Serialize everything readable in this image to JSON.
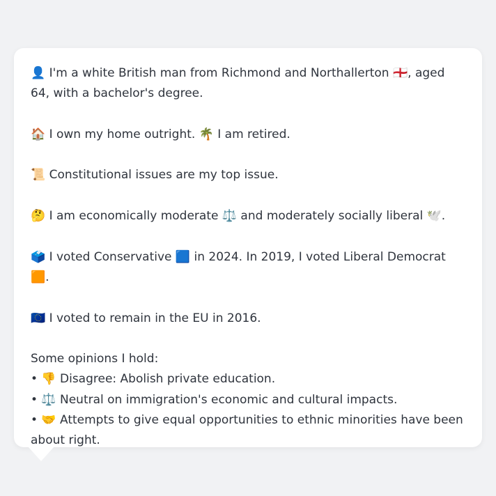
{
  "persona": {
    "intro": "👤 I'm a white British man from Richmond and Northallerton 🏴󠁧󠁢󠁥󠁮󠁧󠁿, aged 64, with a bachelor's degree.",
    "housing": "🏠 I own my home outright. 🌴 I am retired.",
    "top_issue": "📜 Constitutional issues are my top issue.",
    "ideology": "🤔 I am economically moderate ⚖️ and moderately socially liberal 🕊️.",
    "votes": "🗳️ I voted Conservative 🟦 in 2024. In 2019, I voted Liberal Democrat 🟧.",
    "eu": "🇪🇺 I voted to remain in the EU in 2016.",
    "opinions_heading": "Some opinions I hold:",
    "opinions": [
      "• 👎 Disagree: Abolish private education.",
      "• ⚖️ Neutral on immigration's economic and cultural impacts.",
      "• 🤝 Attempts to give equal opportunities to ethnic minorities have been about right."
    ]
  },
  "colors": {
    "background": "#f1f2f4",
    "bubble": "#ffffff",
    "text": "#2f343d"
  }
}
